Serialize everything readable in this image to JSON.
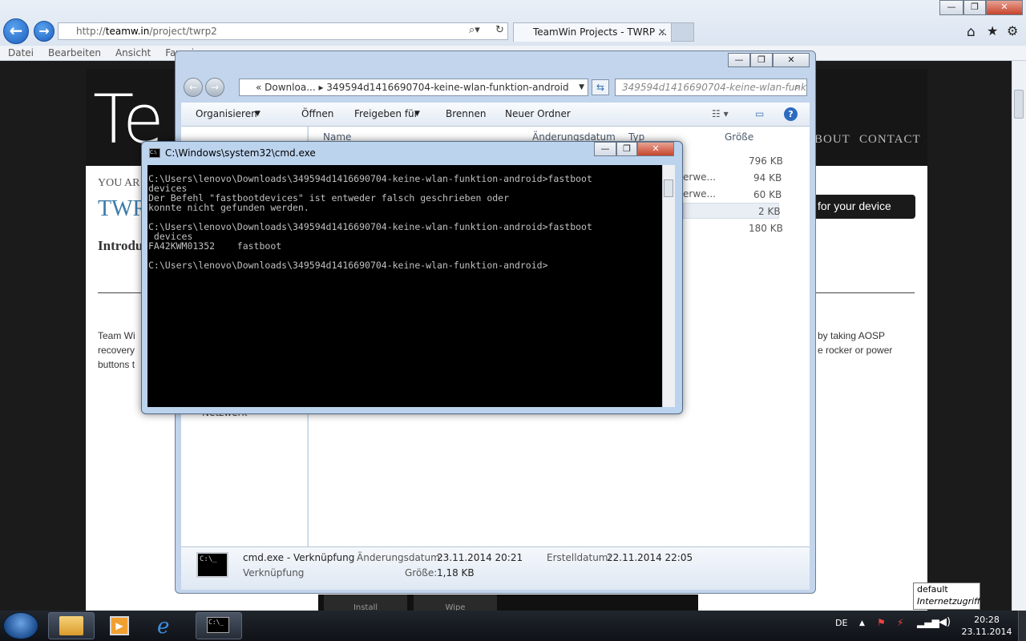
{
  "browser": {
    "url_prefix": "http://",
    "url_host": "teamw.in",
    "url_path": "/project/twrp2",
    "tab_title": "TeamWin Projects - TWRP ...",
    "menu": [
      "Datei",
      "Bearbeiten",
      "Ansicht",
      "Favori"
    ]
  },
  "site": {
    "logo": "Te",
    "nav": [
      "BOUT",
      "CONTACT"
    ],
    "breadcrumb": "YOU AR",
    "title": "TWR",
    "intro": "Introdu",
    "device_button": "for your device",
    "body_left": [
      "Team Wi",
      "recovery",
      "buttons t"
    ],
    "body_right": [
      "by taking AOSP",
      "e rocker or power"
    ]
  },
  "explorer": {
    "breadcrumb_short": "Downloa...",
    "breadcrumb_folder": "349594d1416690704-keine-wlan-funktion-android",
    "search_placeholder": "349594d1416690704-keine-wlan-funkt...",
    "toolbar": [
      "Organisieren",
      "Öffnen",
      "Freigeben für",
      "Brennen",
      "Neuer Ordner"
    ],
    "columns": [
      "Name",
      "Änderungsdatum",
      "Typ",
      "Größe"
    ],
    "rows": [
      {
        "type": "",
        "size": "796 KB"
      },
      {
        "type": "erwe...",
        "size": "94 KB"
      },
      {
        "type": "erwe...",
        "size": "60 KB"
      },
      {
        "type": "",
        "size": "2 KB"
      },
      {
        "type": "",
        "size": "180 KB"
      }
    ],
    "details": {
      "name": "cmd.exe - Verknüpfung",
      "kind": "Verknüpfung",
      "mod_label": "Änderungsdatum:",
      "mod_value": "23.11.2014 20:21",
      "size_label": "Größe:",
      "size_value": "1,18 KB",
      "created_label": "Erstelldatum:",
      "created_value": "22.11.2014 22:05"
    },
    "left_item": "Netzwerk",
    "bottom_tabs": [
      "Install",
      "Wipe"
    ]
  },
  "cmd": {
    "title": "C:\\Windows\\system32\\cmd.exe",
    "output": "C:\\Users\\lenovo\\Downloads\\349594d1416690704-keine-wlan-funktion-android>fastboot\ndevices\nDer Befehl \"fastbootdevices\" ist entweder falsch geschrieben oder\nkonnte nicht gefunden werden.\n\nC:\\Users\\lenovo\\Downloads\\349594d1416690704-keine-wlan-funktion-android>fastboot\n devices\nFA42KWM01352    fastboot\n\nC:\\Users\\lenovo\\Downloads\\349594d1416690704-keine-wlan-funktion-android>"
  },
  "taskbar": {
    "lang": "DE",
    "time": "20:28",
    "date": "23.11.2014",
    "tooltip_line1": "default",
    "tooltip_line2": "Internetzugriff"
  }
}
